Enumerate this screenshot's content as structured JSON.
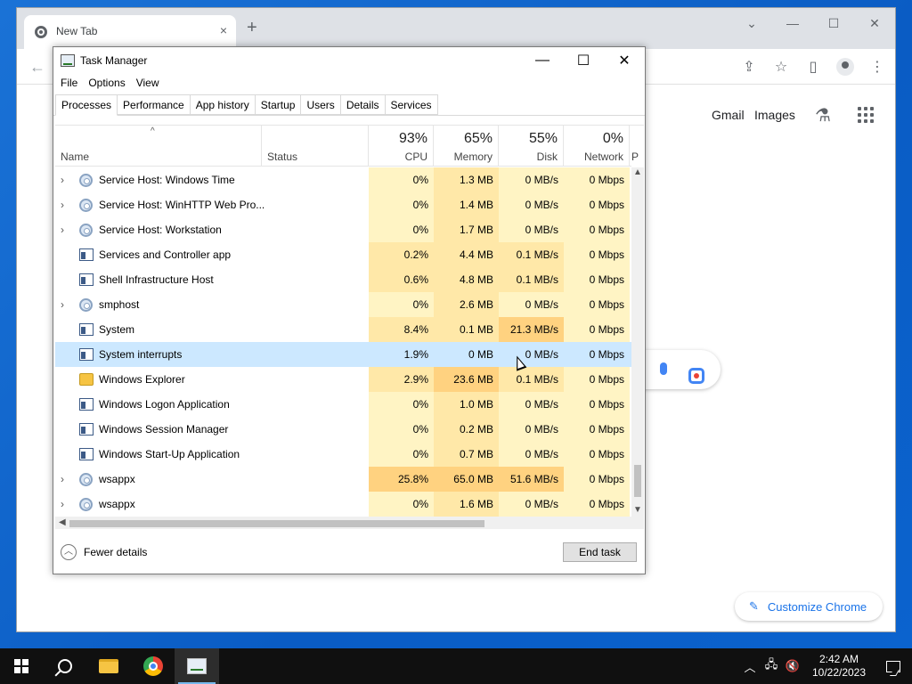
{
  "chrome": {
    "tab_title": "New Tab",
    "tab_close": "×",
    "newtab": "+",
    "window_controls": [
      "⌄",
      "—",
      "☐",
      "✕"
    ],
    "back": "←",
    "toolbar_icons": [
      "share-icon",
      "star-icon",
      "sidepanel-icon",
      "profile-icon",
      "menu-icon"
    ],
    "gmail": "Gmail",
    "images": "Images",
    "customize": "Customize Chrome"
  },
  "task_manager": {
    "title": "Task Manager",
    "controls": [
      "—",
      "☐",
      "✕"
    ],
    "menu": [
      "File",
      "Options",
      "View"
    ],
    "tabs": [
      "Processes",
      "Performance",
      "App history",
      "Startup",
      "Users",
      "Details",
      "Services"
    ],
    "columns": {
      "name": "Name",
      "status": "Status",
      "cpu": {
        "pct": "93%",
        "label": "CPU"
      },
      "memory": {
        "pct": "65%",
        "label": "Memory"
      },
      "disk": {
        "pct": "55%",
        "label": "Disk"
      },
      "network": {
        "pct": "0%",
        "label": "Network"
      },
      "power": "P"
    },
    "rows": [
      {
        "expand": true,
        "icon": "gear",
        "name": "Service Host: Windows Time",
        "cpu": "0%",
        "mem": "1.3 MB",
        "disk": "0 MB/s",
        "net": "0 Mbps"
      },
      {
        "expand": true,
        "icon": "gear",
        "name": "Service Host: WinHTTP Web Pro...",
        "cpu": "0%",
        "mem": "1.4 MB",
        "disk": "0 MB/s",
        "net": "0 Mbps"
      },
      {
        "expand": true,
        "icon": "gear",
        "name": "Service Host: Workstation",
        "cpu": "0%",
        "mem": "1.7 MB",
        "disk": "0 MB/s",
        "net": "0 Mbps"
      },
      {
        "expand": false,
        "icon": "win",
        "name": "Services and Controller app",
        "cpu": "0.2%",
        "mem": "4.4 MB",
        "disk": "0.1 MB/s",
        "net": "0 Mbps"
      },
      {
        "expand": false,
        "icon": "win",
        "name": "Shell Infrastructure Host",
        "cpu": "0.6%",
        "mem": "4.8 MB",
        "disk": "0.1 MB/s",
        "net": "0 Mbps"
      },
      {
        "expand": true,
        "icon": "gear",
        "name": "smphost",
        "cpu": "0%",
        "mem": "2.6 MB",
        "disk": "0 MB/s",
        "net": "0 Mbps"
      },
      {
        "expand": false,
        "icon": "win",
        "name": "System",
        "cpu": "8.4%",
        "mem": "0.1 MB",
        "disk": "21.3 MB/s",
        "net": "0 Mbps"
      },
      {
        "expand": false,
        "icon": "win",
        "name": "System interrupts",
        "cpu": "1.9%",
        "mem": "0 MB",
        "disk": "0 MB/s",
        "net": "0 Mbps",
        "selected": true
      },
      {
        "expand": false,
        "icon": "folder",
        "name": "Windows Explorer",
        "cpu": "2.9%",
        "mem": "23.6 MB",
        "disk": "0.1 MB/s",
        "net": "0 Mbps"
      },
      {
        "expand": false,
        "icon": "win",
        "name": "Windows Logon Application",
        "cpu": "0%",
        "mem": "1.0 MB",
        "disk": "0 MB/s",
        "net": "0 Mbps"
      },
      {
        "expand": false,
        "icon": "win",
        "name": "Windows Session Manager",
        "cpu": "0%",
        "mem": "0.2 MB",
        "disk": "0 MB/s",
        "net": "0 Mbps"
      },
      {
        "expand": false,
        "icon": "win",
        "name": "Windows Start-Up Application",
        "cpu": "0%",
        "mem": "0.7 MB",
        "disk": "0 MB/s",
        "net": "0 Mbps"
      },
      {
        "expand": true,
        "icon": "gear",
        "name": "wsappx",
        "cpu": "25.8%",
        "mem": "65.0 MB",
        "disk": "51.6 MB/s",
        "net": "0 Mbps"
      },
      {
        "expand": true,
        "icon": "gear",
        "name": "wsappx",
        "cpu": "0%",
        "mem": "1.6 MB",
        "disk": "0 MB/s",
        "net": "0 Mbps"
      }
    ],
    "heat_colors": {
      "light": "#fff4c4",
      "medium": "#ffe8a8",
      "strong": "#ffd280",
      "selected": "#cce8ff"
    },
    "fewer_details": "Fewer details",
    "end_task": "End task"
  },
  "taskbar": {
    "time": "2:42 AM",
    "date": "10/22/2023",
    "tray_icons": [
      "chevron-up-icon",
      "network-icon",
      "volume-muted-icon"
    ]
  }
}
